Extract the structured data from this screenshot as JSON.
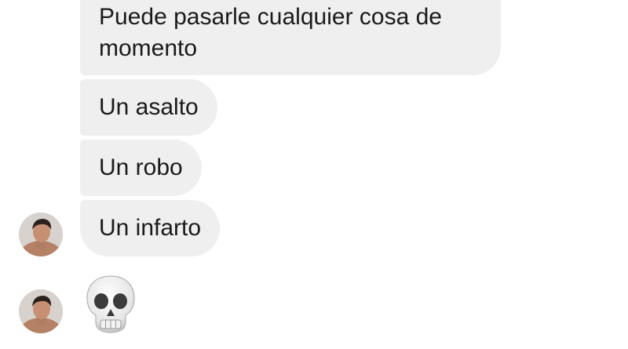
{
  "messages": [
    {
      "text": "Puede pasarle cualquier cosa de momento"
    },
    {
      "text": "Un asalto"
    },
    {
      "text": "Un robo"
    },
    {
      "text": "Un infarto"
    }
  ],
  "emoji_message": {
    "icon": "skull-emoji"
  },
  "colors": {
    "bubble_bg": "#efefef",
    "text": "#1a1a1a",
    "background": "#ffffff"
  }
}
